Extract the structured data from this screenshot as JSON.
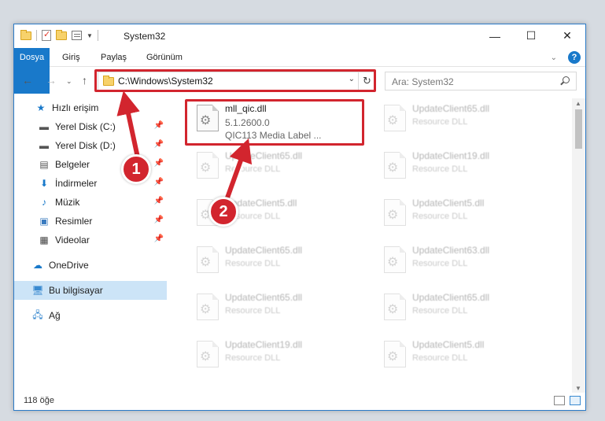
{
  "window": {
    "title": "System32"
  },
  "ribbon": {
    "tabs": [
      "Dosya",
      "Giriş",
      "Paylaş",
      "Görünüm"
    ]
  },
  "nav": {
    "address": "C:\\Windows\\System32",
    "search_placeholder": "Ara: System32"
  },
  "sidebar": {
    "items": [
      {
        "label": "Hızlı erişim",
        "icon": "star-icon",
        "pinned": false
      },
      {
        "label": "Yerel Disk (C:)",
        "icon": "drive-icon",
        "pinned": true
      },
      {
        "label": "Yerel Disk (D:)",
        "icon": "drive-icon",
        "pinned": true
      },
      {
        "label": "Belgeler",
        "icon": "document-icon",
        "pinned": true
      },
      {
        "label": "İndirmeler",
        "icon": "download-icon",
        "pinned": true
      },
      {
        "label": "Müzik",
        "icon": "music-icon",
        "pinned": true
      },
      {
        "label": "Resimler",
        "icon": "pictures-icon",
        "pinned": true
      },
      {
        "label": "Videolar",
        "icon": "video-icon",
        "pinned": true
      },
      {
        "label": "OneDrive",
        "icon": "cloud-icon",
        "pinned": false
      },
      {
        "label": "Bu bilgisayar",
        "icon": "computer-icon",
        "pinned": false,
        "selected": true
      },
      {
        "label": "Ağ",
        "icon": "network-icon",
        "pinned": false
      }
    ]
  },
  "files": [
    {
      "name": "mll_qic.dll",
      "line2": "5.1.2600.0",
      "line3": "QIC113 Media Label ...",
      "blurred": false
    },
    {
      "name": "UpdateClient65.dll",
      "line2": "Resource DLL",
      "blurred": true
    },
    {
      "name": "UpdateClient65.dll",
      "line2": "Resource DLL",
      "blurred": true
    },
    {
      "name": "UpdateClient19.dll",
      "line2": "Resource DLL",
      "blurred": true
    },
    {
      "name": "UpdateClient5.dll",
      "line2": "Resource DLL",
      "blurred": true
    },
    {
      "name": "UpdateClient5.dll",
      "line2": "Resource DLL",
      "blurred": true
    },
    {
      "name": "UpdateClient65.dll",
      "line2": "Resource DLL",
      "blurred": true
    },
    {
      "name": "UpdateClient63.dll",
      "line2": "Resource DLL",
      "blurred": true
    },
    {
      "name": "UpdateClient65.dll",
      "line2": "Resource DLL",
      "blurred": true
    },
    {
      "name": "UpdateClient65.dll",
      "line2": "Resource DLL",
      "blurred": true
    },
    {
      "name": "UpdateClient19.dll",
      "line2": "Resource DLL",
      "blurred": true
    },
    {
      "name": "UpdateClient5.dll",
      "line2": "Resource DLL",
      "blurred": true
    }
  ],
  "status": {
    "count": "118 öğe"
  },
  "annotations": {
    "callout1": "1",
    "callout2": "2"
  },
  "colors": {
    "accent": "#1979ca",
    "highlight": "#d2252e",
    "selected": "#cce4f7"
  }
}
